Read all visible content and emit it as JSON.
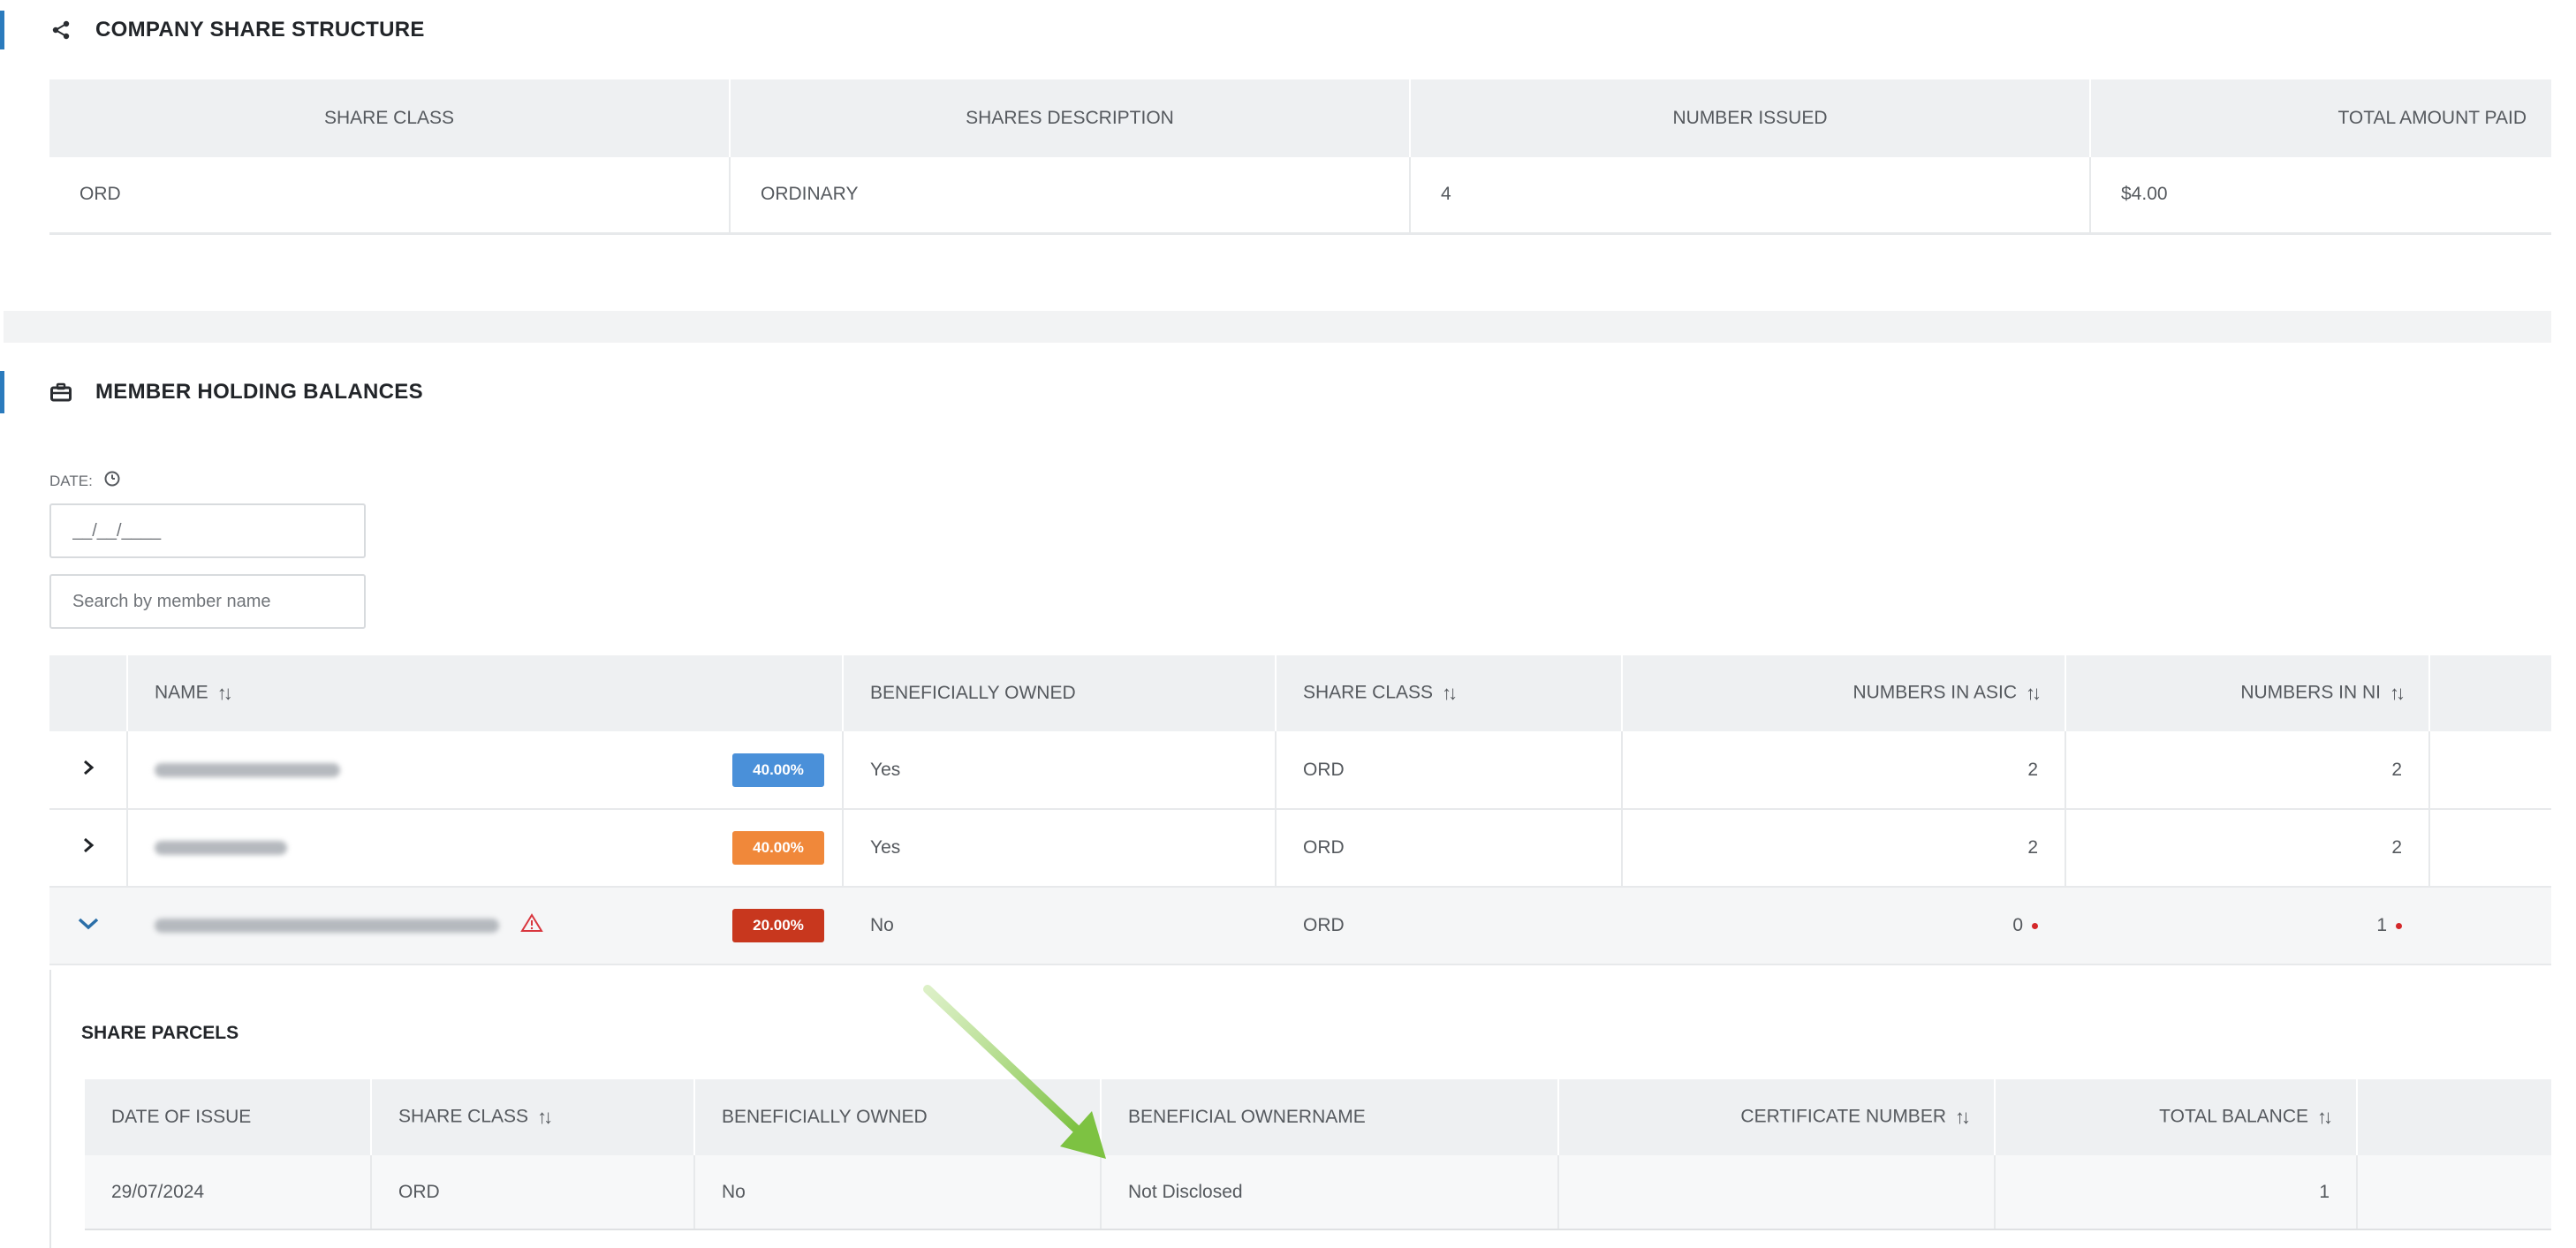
{
  "colors": {
    "accent": "#2b7bbd",
    "badge_blue": "#4a90d9",
    "badge_orange": "#f0883a",
    "badge_red": "#c8371e",
    "warning": "#d9363e",
    "annotation_arrow": "#7dc242"
  },
  "company_share_structure": {
    "title": "COMPANY SHARE STRUCTURE",
    "icon": "share-icon",
    "columns": [
      "SHARE CLASS",
      "SHARES DESCRIPTION",
      "NUMBER ISSUED",
      "TOTAL AMOUNT PAID"
    ],
    "rows": [
      [
        "ORD",
        "ORDINARY",
        "4",
        "$4.00"
      ]
    ]
  },
  "member_holding_balances": {
    "title": "MEMBER HOLDING BALANCES",
    "icon": "briefcase-icon",
    "date_label": "DATE:",
    "date_placeholder": "__/__/____",
    "search_placeholder": "Search by member name",
    "columns": {
      "name": "NAME",
      "beneficially_owned": "BENEFICIALLY OWNED",
      "share_class": "SHARE CLASS",
      "numbers_in_asic": "NUMBERS IN ASIC",
      "numbers_in_ni": "NUMBERS IN NI"
    },
    "rows": [
      {
        "name": "",
        "percent": "40.00%",
        "badge_color": "blue",
        "beneficially_owned": "Yes",
        "share_class": "ORD",
        "asic": "2",
        "ni": "2",
        "expanded": false,
        "warning": false,
        "mismatch": false
      },
      {
        "name": "",
        "percent": "40.00%",
        "badge_color": "orange",
        "beneficially_owned": "Yes",
        "share_class": "ORD",
        "asic": "2",
        "ni": "2",
        "expanded": false,
        "warning": false,
        "mismatch": false
      },
      {
        "name": "",
        "percent": "20.00%",
        "badge_color": "red",
        "beneficially_owned": "No",
        "share_class": "ORD",
        "asic": "0",
        "ni": "1",
        "expanded": true,
        "warning": true,
        "mismatch": true
      }
    ]
  },
  "share_parcels": {
    "title": "SHARE PARCELS",
    "columns": {
      "date_of_issue": "DATE OF ISSUE",
      "share_class": "SHARE CLASS",
      "beneficially_owned": "BENEFICIALLY OWNED",
      "beneficial_ownername": "BENEFICIAL OWNERNAME",
      "certificate_number": "CERTIFICATE NUMBER",
      "total_balance": "TOTAL BALANCE"
    },
    "rows": [
      {
        "date_of_issue": "29/07/2024",
        "share_class": "ORD",
        "beneficially_owned": "No",
        "beneficial_ownername": "Not Disclosed",
        "certificate_number": "",
        "total_balance": "1"
      }
    ]
  }
}
